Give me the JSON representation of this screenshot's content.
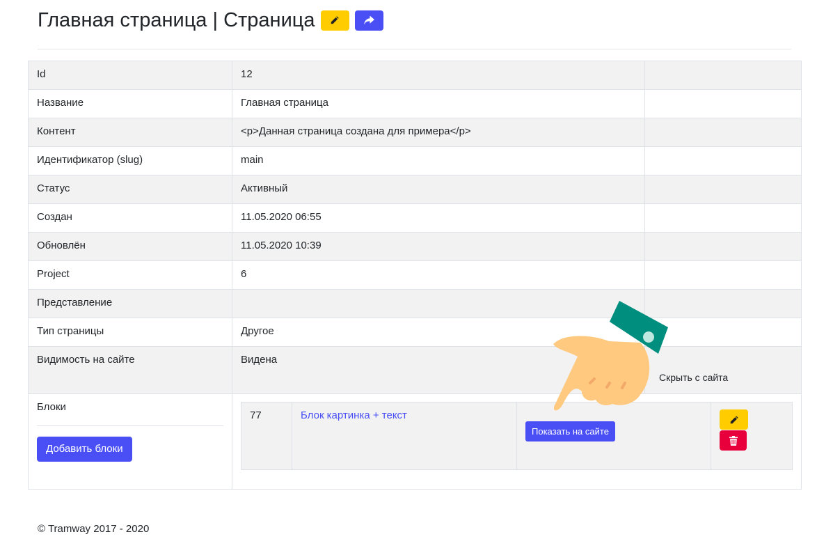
{
  "header": {
    "title": "Главная страница | Страница",
    "edit_icon": "pencil-icon",
    "share_icon": "share-arrow-icon"
  },
  "rows": [
    {
      "label": "Id",
      "value": "12"
    },
    {
      "label": "Название",
      "value": "Главная страница"
    },
    {
      "label": "Контент",
      "value": "<p>Данная страница создана для примера</p>"
    },
    {
      "label": "Идентификатор (slug)",
      "value": "main"
    },
    {
      "label": "Статус",
      "value": "Активный"
    },
    {
      "label": "Создан",
      "value": "11.05.2020 06:55"
    },
    {
      "label": "Обновлён",
      "value": "11.05.2020 10:39"
    },
    {
      "label": "Project",
      "value": "6"
    },
    {
      "label": "Представление",
      "value": ""
    },
    {
      "label": "Тип страницы",
      "value": "Другое"
    }
  ],
  "visibility": {
    "label": "Видимость на сайте",
    "value": "Видена",
    "hide_link": "Скрыть с сайта"
  },
  "blocks": {
    "label": "Блоки",
    "add_button": "Добавить блоки",
    "items": [
      {
        "id": "77",
        "name": "Блок картинка + текст",
        "show_button": "Показать на сайте"
      }
    ]
  },
  "footer": {
    "text": "© Tramway 2017 - 2020"
  },
  "colors": {
    "primary": "#4a4ff5",
    "warning": "#ffcc00",
    "danger": "#e8003d",
    "hand_cuff": "#008e7e",
    "hand_skin": "#ffc97f"
  }
}
